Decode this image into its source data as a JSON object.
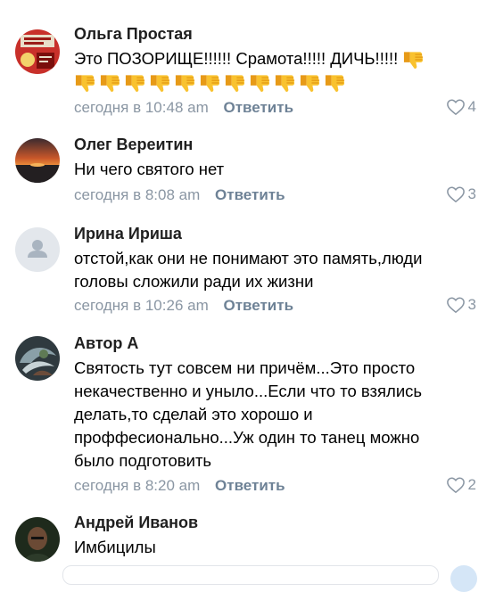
{
  "comments": [
    {
      "author": "Ольга Простая",
      "text_lines": [
        "Это ПОЗОРИЩЕ!!!!!! Срамота!!!!! ДИЧЬ!!!!!"
      ],
      "emoji": "thumbs-down",
      "emoji_inline_count": 1,
      "emoji_row_count": 11,
      "time": "сегодня в 10:48 am",
      "reply_label": "Ответить",
      "likes": "4"
    },
    {
      "author": "Олег Вереитин",
      "text_lines": [
        "Ни чего святого нет"
      ],
      "time": "сегодня в 8:08 am",
      "reply_label": "Ответить",
      "likes": "3"
    },
    {
      "author": "Ирина Ириша",
      "text_lines": [
        "отстой,как они не понимают это память,люди",
        "головы сложили ради их жизни"
      ],
      "time": "сегодня в 10:26 am",
      "reply_label": "Ответить",
      "likes": "3"
    },
    {
      "author": "Автор А",
      "text_lines": [
        "Святость тут совсем ни причём...Это просто",
        "некачественно и уныло...Если что то взялись",
        "делать,то сделай это хорошо и",
        "проффесионально...Уж один то танец можно",
        "было подготовить"
      ],
      "time": "сегодня в 8:20 am",
      "reply_label": "Ответить",
      "likes": "2"
    },
    {
      "author": "Андрей Иванов",
      "text_lines": [
        "Имбицилы"
      ]
    }
  ],
  "icons": {
    "like": "heart-outline-icon",
    "emoji": "thumbs-down-icon",
    "placeholder_avatar": "person-icon"
  },
  "colors": {
    "meta": "#8a96a3",
    "reply": "#6e8296",
    "emoji": "#f5b82e"
  }
}
